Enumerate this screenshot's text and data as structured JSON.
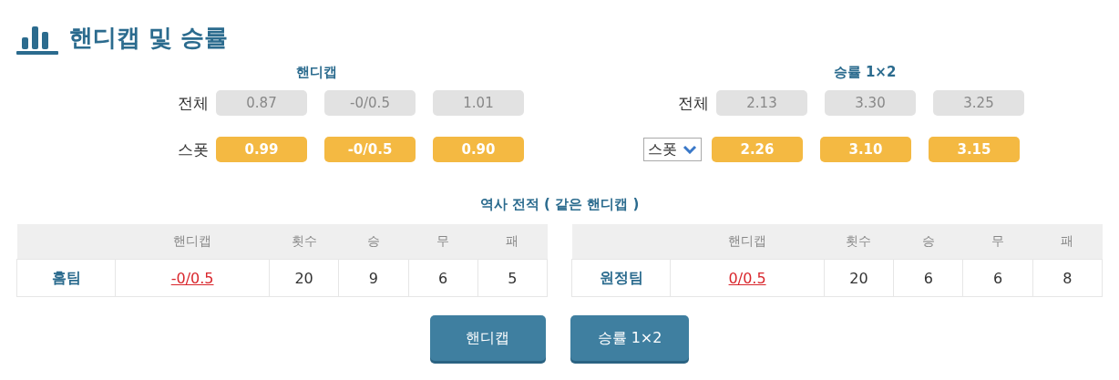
{
  "title": "핸디캡 및 승률",
  "odds_panels": [
    {
      "heading": "핸디캡",
      "rows": [
        {
          "label": {
            "text": "전체",
            "kind": "text"
          },
          "kind": "plain",
          "values": [
            "0.87",
            "-0/0.5",
            "1.01"
          ]
        },
        {
          "label": {
            "text": "스폿",
            "kind": "text"
          },
          "kind": "highlight",
          "values": [
            "0.99",
            "-0/0.5",
            "0.90"
          ]
        }
      ]
    },
    {
      "heading": "승률 1×2",
      "rows": [
        {
          "label": {
            "text": "전체",
            "kind": "text"
          },
          "kind": "plain",
          "values": [
            "2.13",
            "3.30",
            "3.25"
          ]
        },
        {
          "label": {
            "text": "스폿",
            "kind": "dropdown"
          },
          "kind": "highlight",
          "values": [
            "2.26",
            "3.10",
            "3.15"
          ]
        }
      ]
    }
  ],
  "history": {
    "heading": "역사 전적 ( 같은 핸디캡 )",
    "tables": [
      {
        "columns": [
          "핸디캡",
          "횟수",
          "승",
          "무",
          "패"
        ],
        "team": "홈팀",
        "handicap": "-0/0.5",
        "cells": [
          "20",
          "9",
          "6",
          "5"
        ]
      },
      {
        "columns": [
          "핸디캡",
          "횟수",
          "승",
          "무",
          "패"
        ],
        "team": "원정팀",
        "handicap": "0/0.5",
        "cells": [
          "20",
          "6",
          "6",
          "8"
        ]
      }
    ]
  },
  "buttons": [
    "핸디캡",
    "승률 1×2"
  ]
}
